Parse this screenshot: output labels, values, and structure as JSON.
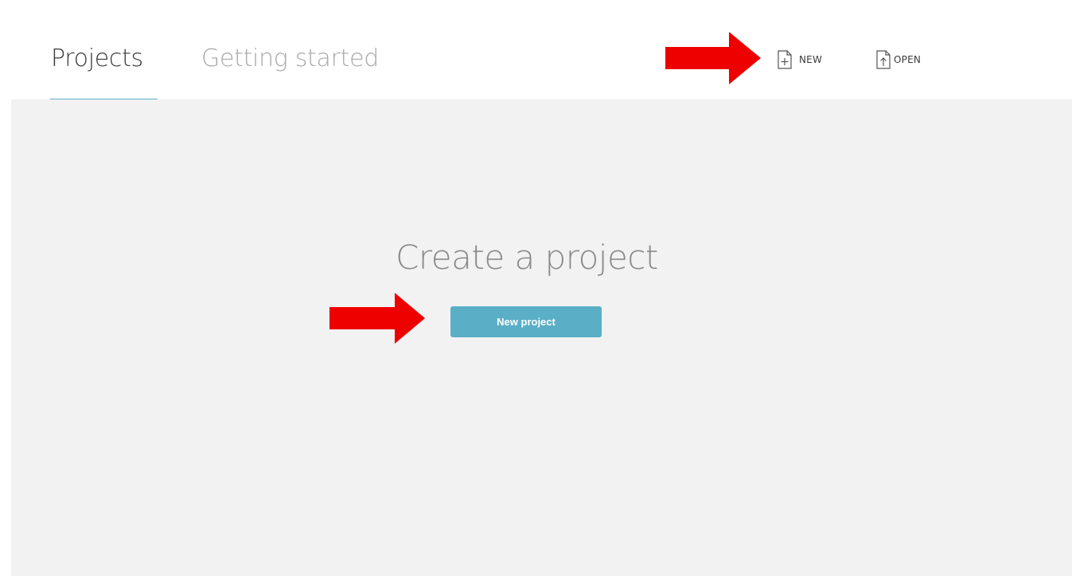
{
  "header": {
    "tabs": [
      {
        "label": "Projects",
        "active": true
      },
      {
        "label": "Getting started",
        "active": false
      }
    ],
    "actions": {
      "new_label": "NEW",
      "open_label": "OPEN"
    }
  },
  "main": {
    "title": "Create a project",
    "new_project_button": "New project"
  },
  "icons": {
    "new": "new-file-icon",
    "open": "open-file-icon"
  },
  "colors": {
    "accent": "#5aafc7",
    "annotation_arrow": "#ee0000",
    "content_background": "#f2f2f2",
    "deco_green_dark": "#6f9a3c",
    "deco_green_light": "#9cc55b"
  }
}
